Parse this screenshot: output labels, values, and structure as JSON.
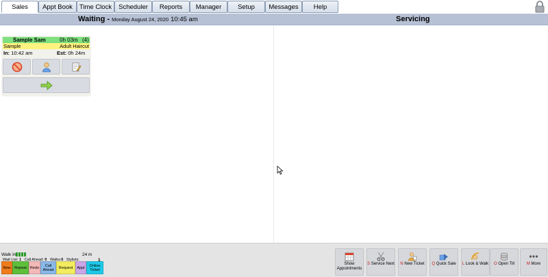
{
  "tabs": [
    {
      "label": "Sales",
      "active": true
    },
    {
      "label": "Appt Book",
      "active": false
    },
    {
      "label": "Time Clock",
      "active": false
    },
    {
      "label": "Scheduler",
      "active": false
    },
    {
      "label": "Reports",
      "active": false
    },
    {
      "label": "Manager",
      "active": false
    },
    {
      "label": "Setup",
      "active": false
    },
    {
      "label": "Messages",
      "active": false
    },
    {
      "label": "Help",
      "active": false
    }
  ],
  "header": {
    "waiting_label": "Waiting -",
    "waiting_date": "Monday August 24, 2020",
    "waiting_time": "10:45 am",
    "servicing_label": "Servicing"
  },
  "waiting_cards": [
    {
      "name": "Sample Sam",
      "duration": "0h 03m",
      "count": "(4)",
      "service_left": "Sample",
      "service_right": "Adult Haircut",
      "in_label": "In:",
      "in_time": "10:42 am",
      "est_label": "Est:",
      "est_time": "0h 24m"
    }
  ],
  "status": {
    "walkin_label": "Walk In",
    "wait_minutes": "24 m",
    "wait_list_label": "Wait List:",
    "wait_list_value": "1",
    "call_ahead_label": "Call Ahead:",
    "call_ahead_value": "0",
    "walks_label": "Walks:",
    "walks_value": "0",
    "stylists_label": "Stylists:",
    "stylists_value": "1"
  },
  "quick_buttons": [
    {
      "label": "New",
      "color": "#f07b1c"
    },
    {
      "label": "Repeat",
      "color": "#5fbf3c"
    },
    {
      "label": "Redo",
      "color": "#f3b8b8"
    },
    {
      "label": "Call Ahead",
      "color": "#8ab8e8"
    },
    {
      "label": "Request",
      "color": "#f2ec5e"
    },
    {
      "label": "Appt",
      "color": "#c9a6e6"
    },
    {
      "label": "Online Ticket",
      "color": "#1ec9e8"
    }
  ],
  "action_buttons": [
    {
      "key": "",
      "label": "Show Appointments",
      "icon": "calendar-icon"
    },
    {
      "key": "S",
      "label": "Service Next",
      "icon": "scissors-icon"
    },
    {
      "key": "N",
      "label": "New Ticket",
      "icon": "person-ticket-icon"
    },
    {
      "key": "Q",
      "label": "Quick Sale",
      "icon": "quick-sale-icon"
    },
    {
      "key": "L",
      "label": "Look & Walk",
      "icon": "look-walk-icon"
    },
    {
      "key": "O",
      "label": "Open Till",
      "icon": "coins-icon"
    },
    {
      "key": "M",
      "label": "More",
      "icon": "more-dots-icon"
    }
  ]
}
